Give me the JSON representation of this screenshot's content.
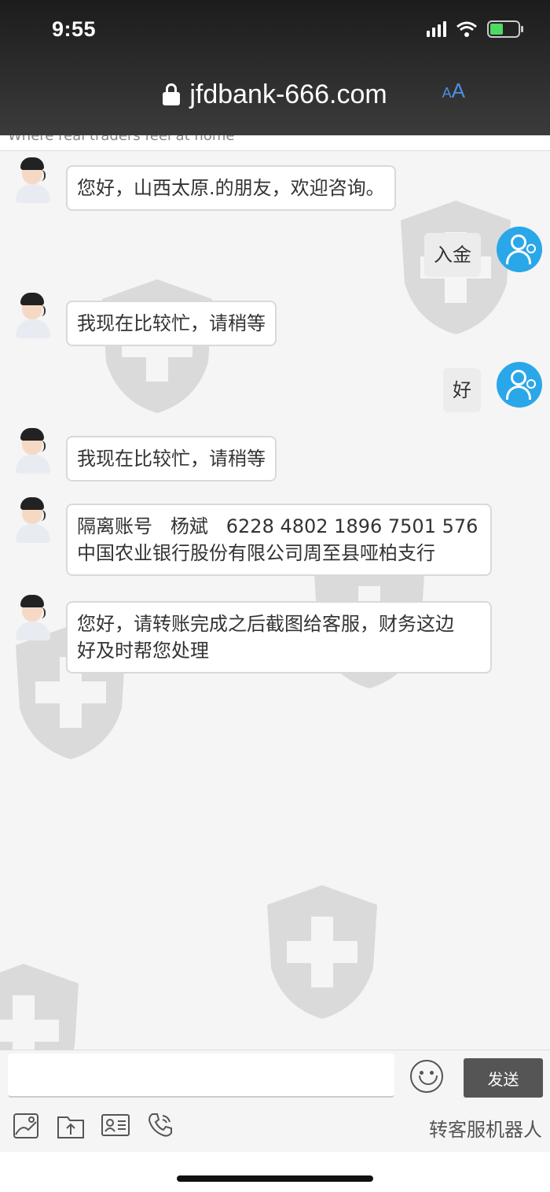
{
  "status_bar": {
    "time": "9:55"
  },
  "browser": {
    "url": "jfdbank-666.com",
    "text_size_small": "A",
    "text_size_large": "A"
  },
  "site_banner": "Where real traders feel at home",
  "chat": {
    "messages": [
      {
        "from": "agent",
        "text": "您好，山西太原.的朋友，欢迎咨询。"
      },
      {
        "from": "user",
        "text": "入金"
      },
      {
        "from": "agent",
        "text": "我现在比较忙，请稍等"
      },
      {
        "from": "user",
        "text": "好"
      },
      {
        "from": "agent",
        "text": "我现在比较忙，请稍等"
      },
      {
        "from": "agent",
        "line1": "隔离账号   杨斌   6228 4802 1896 7501 576",
        "line2": "中国农业银行股份有限公司周至县哑柏支行"
      },
      {
        "from": "agent",
        "line1": "您好，请转账完成之后截图给客服，财务这边",
        "line2": "好及时帮您处理"
      }
    ]
  },
  "composer": {
    "send_label": "发送",
    "input_value": ""
  },
  "toolbar": {
    "icons": [
      "image-icon",
      "folder-upload-icon",
      "id-card-icon",
      "phone-icon"
    ],
    "transfer_label": "转客服机器人"
  }
}
